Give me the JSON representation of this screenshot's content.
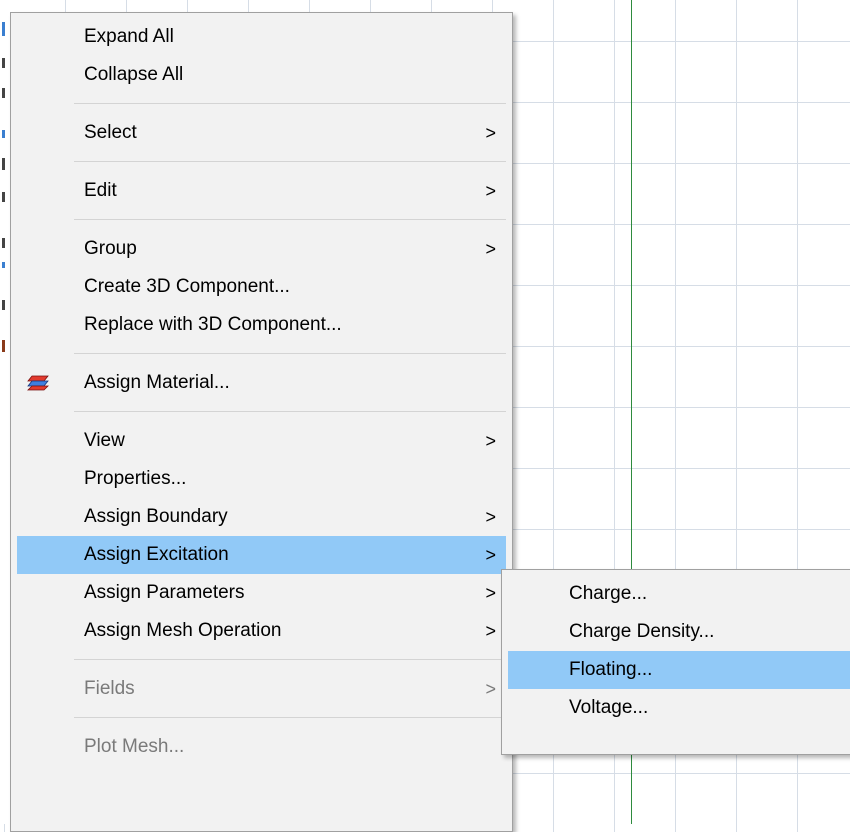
{
  "context_menu": {
    "items": [
      {
        "label": "Expand All"
      },
      {
        "label": "Collapse All"
      },
      {
        "label": "Select",
        "arrow": ">"
      },
      {
        "label": "Edit",
        "arrow": ">"
      },
      {
        "label": "Group",
        "arrow": ">"
      },
      {
        "label": "Create 3D Component..."
      },
      {
        "label": "Replace with 3D Component..."
      },
      {
        "label": "Assign Material...",
        "icon": "material-icon"
      },
      {
        "label": "View",
        "arrow": ">"
      },
      {
        "label": "Properties..."
      },
      {
        "label": "Assign Boundary",
        "arrow": ">"
      },
      {
        "label": "Assign Excitation",
        "arrow": ">",
        "state": "highlighted"
      },
      {
        "label": "Assign Parameters",
        "arrow": ">"
      },
      {
        "label": "Assign Mesh Operation",
        "arrow": ">"
      },
      {
        "label": "Fields",
        "arrow": ">",
        "state": "disabled"
      },
      {
        "label": "Plot Mesh...",
        "state": "disabled"
      }
    ]
  },
  "submenu": {
    "items": [
      {
        "label": "Charge..."
      },
      {
        "label": "Charge Density..."
      },
      {
        "label": "Floating...",
        "state": "highlighted"
      },
      {
        "label": "Voltage..."
      }
    ]
  },
  "colors": {
    "highlight": "#91c9f7",
    "menu_background": "#f2f2f2",
    "grid_line": "#d6dde6",
    "axis_line": "#2e8b3e",
    "disabled_text": "#7a7a7a"
  }
}
